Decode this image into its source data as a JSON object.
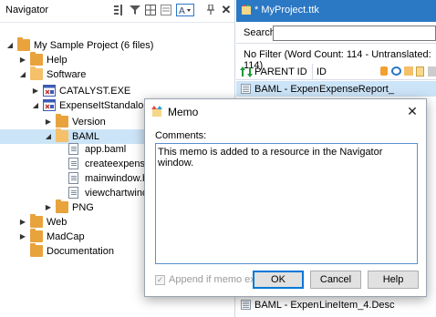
{
  "navigator": {
    "title": "Navigator",
    "toolbar_icons": [
      "move-icon",
      "filter-icon",
      "grid-icon",
      "list-icon",
      "text-mode-icon",
      "pin-icon",
      "close-icon"
    ],
    "tree": [
      {
        "label": "My Sample Project (6 files)",
        "icon": "project-folder-icon",
        "expander": "collapse",
        "selected": false
      },
      {
        "label": "Help",
        "icon": "folder-icon",
        "expander": "expand",
        "selected": false
      },
      {
        "label": "Software",
        "icon": "folder-open-icon",
        "expander": "collapse",
        "selected": false
      },
      {
        "label": "CATALYST.EXE",
        "icon": "exe-icon",
        "expander": "expand",
        "selected": false
      },
      {
        "label": "ExpenseItStandalone.exe",
        "icon": "exe-icon",
        "expander": "collapse",
        "selected": false
      },
      {
        "label": "Version",
        "icon": "folder-icon",
        "expander": "expand",
        "selected": false
      },
      {
        "label": "BAML",
        "icon": "folder-open-icon",
        "expander": "collapse",
        "selected": true
      },
      {
        "label": "app.baml",
        "icon": "file-icon",
        "expander": "",
        "selected": false
      },
      {
        "label": "createexpensereportpage.baml",
        "icon": "file-icon",
        "expander": "",
        "selected": false
      },
      {
        "label": "mainwindow.baml",
        "icon": "file-icon",
        "expander": "",
        "selected": false
      },
      {
        "label": "viewchartwindow.baml",
        "icon": "file-icon",
        "expander": "",
        "selected": false
      },
      {
        "label": "PNG",
        "icon": "folder-icon",
        "expander": "expand",
        "selected": false
      },
      {
        "label": "Web",
        "icon": "folder-icon",
        "expander": "expand",
        "selected": false
      },
      {
        "label": "MadCap",
        "icon": "folder-icon",
        "expander": "expand",
        "selected": false
      },
      {
        "label": "Documentation",
        "icon": "folder-icon",
        "expander": "",
        "selected": false
      }
    ]
  },
  "editor": {
    "tab_title": "* MyProject.ttk",
    "search_label": "Search",
    "search_value": "",
    "filter_text": "No Filter (Word Count: 114 - Untranslated: 114)",
    "columns": {
      "parent_id": "PARENT ID",
      "id": "ID"
    },
    "rows": [
      {
        "parent_id": "BAML - Expense",
        "id": "ExpenseReport_",
        "selected": true
      },
      {
        "parent_id": "BAML - Expense",
        "id": "LineItem_4.Desc",
        "selected": false
      }
    ]
  },
  "memo_dialog": {
    "title": "Memo",
    "comments_label": "Comments:",
    "comments_value": "This memo is added to a resource in the Navigator window.",
    "append_label": "Append if memo exists",
    "append_checked": true,
    "ok_label": "OK",
    "cancel_label": "Cancel",
    "help_label": "Help"
  },
  "colors": {
    "tab_active": "#2b78c5",
    "selection": "#cce4f7",
    "folder": "#e8a33d",
    "default_button_border": "#0078d7"
  }
}
